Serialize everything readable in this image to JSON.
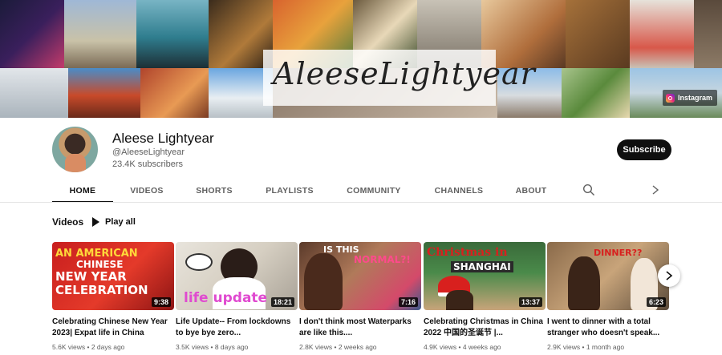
{
  "banner": {
    "title": "AleeseLightyear",
    "instagram_label": "Instagram"
  },
  "channel": {
    "name": "Aleese Lightyear",
    "handle": "@AleeseLightyear",
    "subscribers": "23.4K subscribers",
    "subscribe_label": "Subscribe"
  },
  "tabs": [
    {
      "label": "HOME"
    },
    {
      "label": "VIDEOS"
    },
    {
      "label": "SHORTS"
    },
    {
      "label": "PLAYLISTS"
    },
    {
      "label": "COMMUNITY"
    },
    {
      "label": "CHANNELS"
    },
    {
      "label": "ABOUT"
    }
  ],
  "shelf": {
    "title": "Videos",
    "play_all_label": "Play all"
  },
  "videos": [
    {
      "title": "Celebrating Chinese New Year 2023| Expat life in China",
      "duration": "9:38",
      "views": "5.6K views",
      "age": "2 days ago",
      "thumb_text": [
        "AN AMERICAN",
        "CHINESE",
        "NEW YEAR",
        "CELEBRATION"
      ]
    },
    {
      "title": "Life Update-- From lockdowns to bye bye zero...",
      "duration": "18:21",
      "views": "3.5K views",
      "age": "8 days ago",
      "thumb_text": [
        "life update"
      ]
    },
    {
      "title": "I don't think most Waterparks are like this....",
      "duration": "7:16",
      "views": "2.8K views",
      "age": "2 weeks ago",
      "thumb_text": [
        "IS THIS",
        "NORMAL?!"
      ]
    },
    {
      "title": "Celebrating Christmas in China 2022 中国的圣诞节 |...",
      "duration": "13:37",
      "views": "4.9K views",
      "age": "4 weeks ago",
      "thumb_text": [
        "Christmas in",
        "SHANGHAI"
      ]
    },
    {
      "title": "I went to dinner with a total stranger who doesn't speak...",
      "duration": "6:23",
      "views": "2.9K views",
      "age": "1 month ago",
      "thumb_text": [
        "DINNER??"
      ]
    }
  ],
  "colors": {
    "subscribe_bg": "#0f0f0f",
    "accent_red": "#cc1e1e",
    "meta_gray": "#606060"
  }
}
